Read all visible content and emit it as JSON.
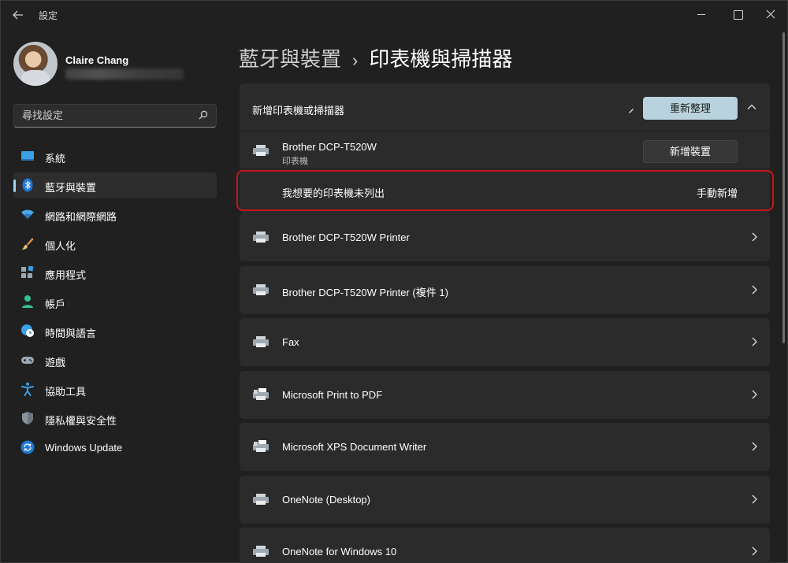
{
  "window": {
    "title": "設定"
  },
  "profile": {
    "name": "Claire Chang"
  },
  "search": {
    "placeholder": "尋找設定"
  },
  "nav": {
    "items": [
      {
        "label": "系統",
        "icon": "system-icon"
      },
      {
        "label": "藍牙與裝置",
        "icon": "bluetooth-icon",
        "active": true
      },
      {
        "label": "網路和網際網路",
        "icon": "wifi-icon"
      },
      {
        "label": "個人化",
        "icon": "brush-icon"
      },
      {
        "label": "應用程式",
        "icon": "apps-icon"
      },
      {
        "label": "帳戶",
        "icon": "account-icon"
      },
      {
        "label": "時間與語言",
        "icon": "globe-clock-icon"
      },
      {
        "label": "遊戲",
        "icon": "gamepad-icon"
      },
      {
        "label": "協助工具",
        "icon": "accessibility-icon"
      },
      {
        "label": "隱私權與安全性",
        "icon": "shield-icon"
      },
      {
        "label": "Windows Update",
        "icon": "update-icon"
      }
    ]
  },
  "header": {
    "parent": "藍牙與裝置",
    "separator": "›",
    "current": "印表機與掃描器"
  },
  "add_section": {
    "label": "新增印表機或掃描器",
    "refresh_label": "重新整理",
    "found_device": {
      "name": "Brother DCP-T520W",
      "type": "印表機",
      "add_label": "新增裝置"
    },
    "manual": {
      "label": "我想要的印表機未列出",
      "link": "手動新增"
    }
  },
  "printers": [
    {
      "name": "Brother DCP-T520W Printer",
      "icon": "printer-icon"
    },
    {
      "name": "Brother DCP-T520W Printer (複件 1)",
      "icon": "printer-icon"
    },
    {
      "name": "Fax",
      "icon": "printer-icon"
    },
    {
      "name": "Microsoft Print to PDF",
      "icon": "pdf-printer-icon"
    },
    {
      "name": "Microsoft XPS Document Writer",
      "icon": "pdf-printer-icon"
    },
    {
      "name": "OneNote (Desktop)",
      "icon": "printer-icon"
    },
    {
      "name": "OneNote for Windows 10",
      "icon": "printer-icon"
    }
  ],
  "colors": {
    "accent": "#9ed3ee",
    "highlight": "#c7141c",
    "refresh_button": "#b9d3de"
  }
}
